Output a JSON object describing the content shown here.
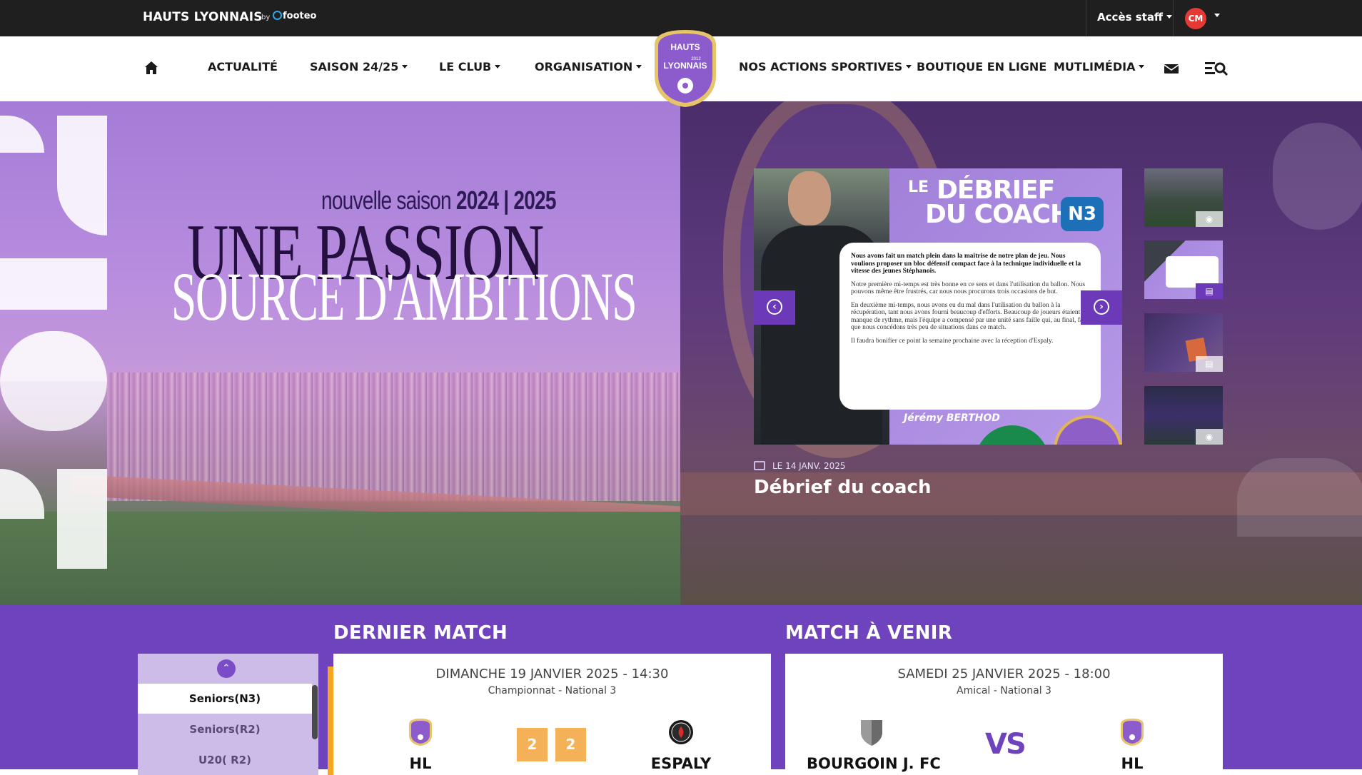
{
  "topbar": {
    "brand": "HAUTS LYONNAIS",
    "by": "by",
    "provider": "footeo",
    "staff_access": "Accès staff",
    "avatar_initials": "CM"
  },
  "nav": {
    "items": [
      {
        "label": "ACTUALITÉ",
        "dropdown": false
      },
      {
        "label": "SAISON 24/25",
        "dropdown": true
      },
      {
        "label": "LE CLUB",
        "dropdown": true
      },
      {
        "label": "ORGANISATION",
        "dropdown": true
      },
      {
        "label": "NOS ACTIONS SPORTIVES",
        "dropdown": true
      },
      {
        "label": "BOUTIQUE EN LIGNE",
        "dropdown": false
      },
      {
        "label": "MUTLIMÉDIA",
        "dropdown": true
      }
    ],
    "logo": {
      "line1": "HAUTS",
      "line2": "LYONNAIS",
      "year": "2012"
    }
  },
  "hero": {
    "subtitle_a": "nouvelle saison ",
    "subtitle_b": "2024 | 2025",
    "title_line1": "UNE PASSION",
    "title_line2": "SOURCE D'AMBITIONS"
  },
  "slider": {
    "card_title_1": "LE",
    "card_title_2": "DÉBRIEF",
    "card_title_3": "DU COACH",
    "card_badge": "N3",
    "quote": {
      "p1": "Nous avons fait un match plein dans la maîtrise de notre plan de jeu. Nous voulions proposer un bloc défensif compact face à la technique individuelle et la vitesse des jeunes Stéphanois.",
      "p2": "Notre première mi-temps est très bonne en ce sens et dans l'utilisation du ballon. Nous pouvons même être frustrés, car nous nous procurons trois occasions de but.",
      "p3": "En deuxième mi-temps, nous avons eu du mal dans l'utilisation du ballon à la récupération, tant nous avons fourni beaucoup d'efforts. Beaucoup de joueurs étaient en manque de rythme, mais l'équipe a compensé par une unité sans faille qui, au final, fait que nous concédons très peu de situations dans ce match.",
      "p4": "Il faudra bonifier ce point la semaine prochaine avec la réception d'Espaly."
    },
    "signature": "Jérémy BERTHOD",
    "news_date": "LE 14 JANV. 2025",
    "news_title": "Débrief du coach",
    "thumbnails": [
      {
        "type": "camera-icon"
      },
      {
        "type": "news-icon"
      },
      {
        "type": "news-icon"
      },
      {
        "type": "camera-icon"
      }
    ]
  },
  "matches": {
    "last_title": "DERNIER MATCH",
    "next_title": "MATCH À VENIR",
    "teams": [
      "Seniors(N3)",
      "Seniors(R2)",
      "U20( R2)"
    ],
    "last": {
      "date": "DIMANCHE 19 JANVIER 2025 - 14:30",
      "competition": "Championnat - National 3",
      "home": "HL",
      "away": "ESPALY",
      "home_score": "2",
      "away_score": "2"
    },
    "next": {
      "date": "SAMEDI 25 JANVIER 2025 - 18:00",
      "competition": "Amical - National 3",
      "home": "BOURGOIN J. FC",
      "away": "HL",
      "vs": "VS"
    }
  },
  "colors": {
    "brand_purple": "#6f43bd",
    "accent_orange": "#f5a623",
    "score_bg": "#f5b158",
    "topbar": "#1f1f1f"
  }
}
